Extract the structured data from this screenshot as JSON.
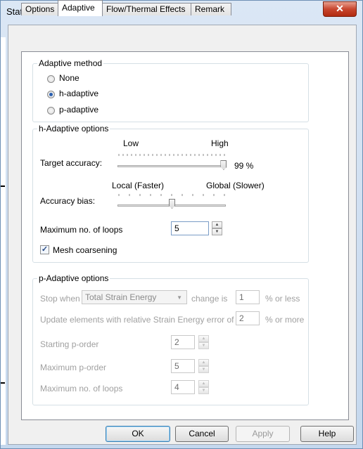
{
  "window": {
    "title": "Static",
    "close_glyph": "✕"
  },
  "tabs": [
    "Options",
    "Adaptive",
    "Flow/Thermal Effects",
    "Remark"
  ],
  "adaptive_method": {
    "title": "Adaptive method",
    "options": [
      "None",
      "h-adaptive",
      "p-adaptive"
    ],
    "selected": "h-adaptive"
  },
  "h_adaptive": {
    "title": "h-Adaptive options",
    "target_accuracy": {
      "label": "Target accuracy:",
      "low": "Low",
      "high": "High",
      "value_text": "99 %",
      "level": 0.99
    },
    "accuracy_bias": {
      "label": "Accuracy bias:",
      "low": "Local (Faster)",
      "high": "Global (Slower)",
      "level": 0.5
    },
    "max_loops": {
      "label": "Maximum no. of loops",
      "value": "5"
    },
    "mesh_coarsening": {
      "label": "Mesh coarsening",
      "checked": true
    }
  },
  "p_adaptive": {
    "title": "p-Adaptive options",
    "stop_when": "Stop when",
    "criterion": "Total Strain Energy",
    "change_is": "change is",
    "change_value": "1",
    "or_less": "% or less",
    "update_label": "Update elements with relative Strain Energy error of",
    "update_value": "2",
    "or_more": "% or more",
    "starting_order": {
      "label": "Starting p-order",
      "value": "2"
    },
    "max_order": {
      "label": "Maximum p-order",
      "value": "5"
    },
    "max_loops": {
      "label": "Maximum no. of loops",
      "value": "4"
    }
  },
  "buttons": {
    "ok": "OK",
    "cancel": "Cancel",
    "apply": "Apply",
    "help": "Help"
  }
}
